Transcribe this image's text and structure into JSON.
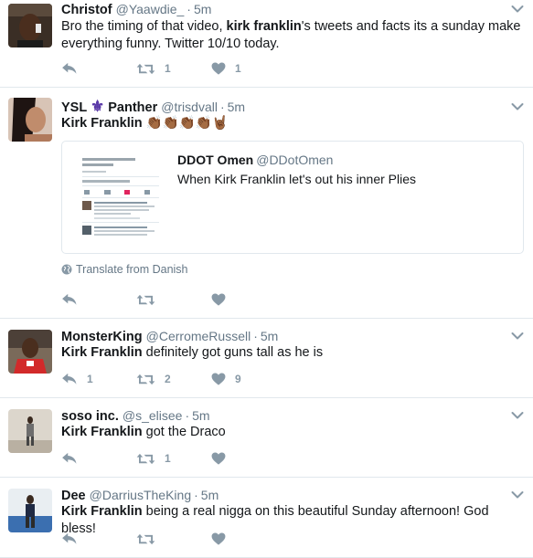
{
  "tweets": [
    {
      "name": "Christof",
      "handle": "@Yaawdie_",
      "time": "5m",
      "text_parts": [
        "Bro the timing of that video, ",
        "kirk franklin",
        "'s tweets and facts its a sunday make everything funny. Twitter 10/10 today."
      ],
      "reply_count": "",
      "retweet_count": "1",
      "like_count": "1"
    },
    {
      "name_part1": "YSL",
      "name_emoji": "⚜",
      "name_part2": "Panther",
      "handle": "@trisdvall",
      "time": "5m",
      "text_bold": "Kirk Franklin",
      "text_emoji": "👏🏾👏🏾👏🏾👏🏾🤘🏾",
      "quote": {
        "name": "DDOT Omen",
        "handle": "@DDotOmen",
        "text": "When Kirk Franklin let's out his inner Plies"
      },
      "translate_label": "Translate from Danish",
      "reply_count": "",
      "retweet_count": "",
      "like_count": ""
    },
    {
      "name": "MonsterKing",
      "handle": "@CerromeRussell",
      "time": "5m",
      "text_bold": "Kirk Franklin",
      "text_rest": " definitely got guns tall as he is",
      "reply_count": "1",
      "retweet_count": "2",
      "like_count": "9"
    },
    {
      "name": "soso inc.",
      "handle": "@s_elisee",
      "time": "5m",
      "text_bold": "Kirk Franklin",
      "text_rest": " got the Draco",
      "reply_count": "",
      "retweet_count": "1",
      "like_count": ""
    },
    {
      "name": "Dee",
      "handle": "@DarriusTheKing",
      "time": "5m",
      "text_bold": "Kirk Franklin",
      "text_rest": " being a real nigga on this beautiful Sunday afternoon! God bless!",
      "reply_count": "",
      "retweet_count": "",
      "like_count": ""
    }
  ],
  "dot": "·",
  "colors": {
    "name": "#14171a",
    "secondary": "#657786",
    "icon": "#8899a6",
    "border": "#e1e8ed"
  },
  "icons": [
    "reply-icon",
    "retweet-icon",
    "heart-icon",
    "caret-down-icon",
    "globe-icon"
  ]
}
